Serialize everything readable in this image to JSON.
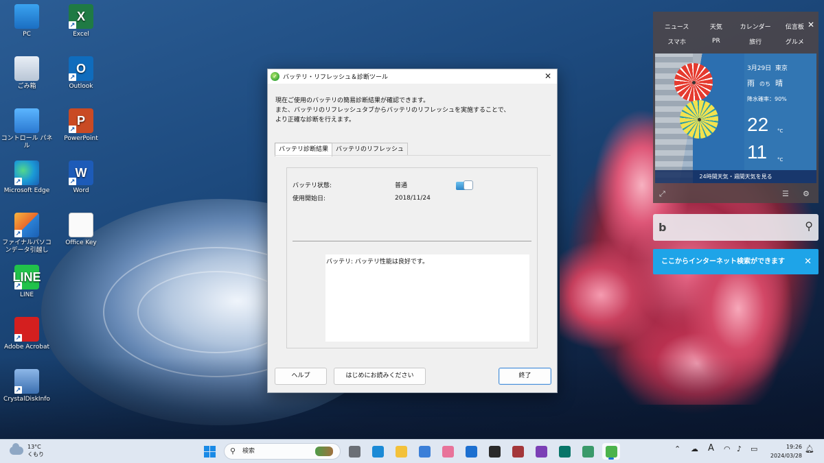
{
  "desktop_icons": [
    {
      "label": "PC",
      "icon": "monitor-icon"
    },
    {
      "label": "ごみ箱",
      "icon": "recycle-bin-icon"
    },
    {
      "label": "コントロール パネル",
      "icon": "control-panel-icon"
    },
    {
      "label": "Microsoft Edge",
      "icon": "edge-icon"
    },
    {
      "label": "ファイナルパソコンデータ引越し",
      "icon": "data-transfer-icon"
    },
    {
      "label": "LINE",
      "icon": "line-icon",
      "glyph": "LINE"
    },
    {
      "label": "Adobe Acrobat",
      "icon": "acrobat-icon"
    },
    {
      "label": "CrystalDiskInfo",
      "icon": "crystaldiskinfo-icon"
    },
    {
      "label": "Excel",
      "icon": "excel-icon",
      "glyph": "X"
    },
    {
      "label": "Outlook",
      "icon": "outlook-icon",
      "glyph": "O"
    },
    {
      "label": "PowerPoint",
      "icon": "powerpoint-icon",
      "glyph": "P"
    },
    {
      "label": "Word",
      "icon": "word-icon",
      "glyph": "W"
    },
    {
      "label": "Office Key",
      "icon": "document-icon"
    }
  ],
  "dialog": {
    "title": "バッテリ・リフレッシュ＆診断ツール",
    "close_glyph": "✕",
    "intro": [
      "現在ご使用のバッテリの簡易診断結果が確認できます。",
      "また、バッテリのリフレッシュタブからバッテリのリフレッシュを実施することで、",
      "より正確な診断を行えます。"
    ],
    "tabs": [
      "バッテリ診断結果",
      "バッテリのリフレッシュ"
    ],
    "active_tab": 0,
    "status_label": "バッテリ状態:",
    "status_value": "普通",
    "start_label": "使用開始日:",
    "start_value": "2018/11/24",
    "result_text": "バッテリ: バッテリ性能は良好です。",
    "buttons": {
      "help": "ヘルプ",
      "readme": "はじめにお読みください",
      "exit": "終了"
    }
  },
  "widget": {
    "nav_row1": [
      "ニュース",
      "天気",
      "カレンダー",
      "伝言板"
    ],
    "nav_row2": [
      "スマホ",
      "PR",
      "旅行",
      "グルメ"
    ],
    "close_glyph": "✕",
    "date": "3月29日",
    "city": "東京",
    "condition_a": "雨",
    "condition_mid": "のち",
    "condition_b": "晴",
    "rain_chance": "降水確率：90%",
    "high": "22",
    "low": "11",
    "unit": "°C",
    "forecast_link": "24時間天気・週間天気を見る"
  },
  "bing": {
    "logo": "b",
    "tip": "ここからインターネット検索ができます",
    "tip_close": "✕"
  },
  "taskbar": {
    "temp": "13°C",
    "weather": "くもり",
    "search_placeholder": "検索",
    "apps": [
      {
        "icon": "task-view-icon",
        "color": "#6b6f76"
      },
      {
        "icon": "edge-icon",
        "color": "#1b8ad6"
      },
      {
        "icon": "file-explorer-icon",
        "color": "#f3c13a"
      },
      {
        "icon": "store-icon",
        "color": "#3b7fd8"
      },
      {
        "icon": "photos-icon",
        "color": "#e8739a"
      },
      {
        "icon": "mail-icon",
        "color": "#1c6fd0"
      },
      {
        "icon": "snipping-tool-icon",
        "color": "#2a2a2a"
      },
      {
        "icon": "access-icon",
        "color": "#a4373a"
      },
      {
        "icon": "onenote-icon",
        "color": "#7b3fb5"
      },
      {
        "icon": "publisher-icon",
        "color": "#077568"
      },
      {
        "icon": "globe-icon",
        "color": "#3a9a6a"
      },
      {
        "icon": "battery-tool-icon",
        "color": "#4cb34c"
      }
    ],
    "ime": "A",
    "time": "19:26",
    "date": "2024/03/28"
  }
}
